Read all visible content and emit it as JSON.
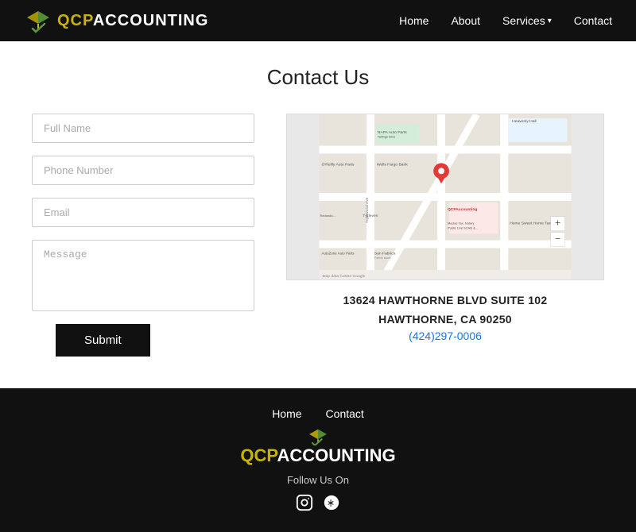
{
  "header": {
    "logo": {
      "qcp": "QCP",
      "accounting": "ACCOUNTING"
    },
    "nav": {
      "home": "Home",
      "about": "About",
      "services": "Services",
      "contact": "Contact"
    }
  },
  "main": {
    "title": "Contact Us",
    "form": {
      "full_name_placeholder": "Full Name",
      "phone_placeholder": "Phone Number",
      "email_placeholder": "Email",
      "message_placeholder": "Message",
      "submit_label": "Submit"
    },
    "address": {
      "line1": "13624 HAWTHORNE BLVD SUITE 102",
      "line2": "HAWTHORNE, CA 90250",
      "phone": "(424)297-0006"
    }
  },
  "footer": {
    "nav": {
      "home": "Home",
      "contact": "Contact"
    },
    "logo_qcp": "QCP",
    "logo_acc": "ACCOUNTING",
    "follow_us": "Follow Us On"
  }
}
